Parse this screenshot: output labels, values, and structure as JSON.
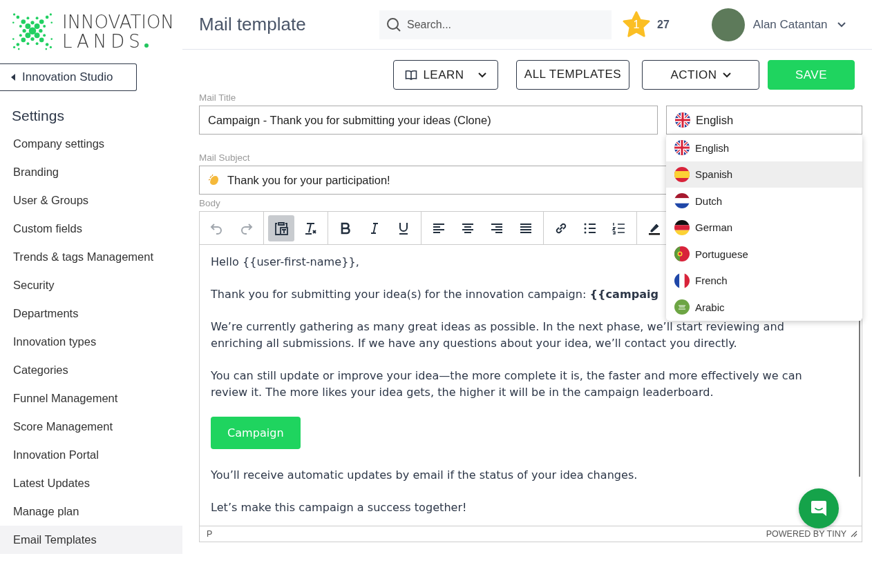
{
  "logo": {
    "line1": "INNOVATION",
    "line2": "LANDS"
  },
  "sidebar": {
    "back_button": "Innovation Studio",
    "heading": "Settings",
    "items": [
      {
        "label": "Company settings",
        "selected": false
      },
      {
        "label": "Branding",
        "selected": false
      },
      {
        "label": "User & Groups",
        "selected": false
      },
      {
        "label": "Custom fields",
        "selected": false
      },
      {
        "label": "Trends & tags Management",
        "selected": false
      },
      {
        "label": "Security",
        "selected": false
      },
      {
        "label": "Departments",
        "selected": false
      },
      {
        "label": "Innovation types",
        "selected": false
      },
      {
        "label": "Categories",
        "selected": false
      },
      {
        "label": "Funnel Management",
        "selected": false
      },
      {
        "label": "Score Management",
        "selected": false
      },
      {
        "label": "Innovation Portal",
        "selected": false
      },
      {
        "label": "Latest Updates",
        "selected": false
      },
      {
        "label": "Manage plan",
        "selected": false
      },
      {
        "label": "Email Templates",
        "selected": true
      }
    ]
  },
  "header": {
    "title": "Mail template",
    "search": {
      "placeholder": "Search..."
    },
    "badge": {
      "level": "1",
      "points": "27"
    },
    "user": {
      "name": "Alan Catantan"
    }
  },
  "actions": [
    {
      "label": "LEARN",
      "kind": "guide"
    },
    {
      "label": "ALL TEMPLATES",
      "kind": "plain"
    },
    {
      "label": "ACTION",
      "kind": "menu"
    },
    {
      "label": "SAVE",
      "kind": "primary"
    }
  ],
  "form": {
    "title_label": "Mail Title",
    "title_value": "Campaign - Thank you for submitting your ideas (Clone)",
    "language": {
      "value": "English",
      "kind": "uk"
    },
    "subject_label": "Mail Subject",
    "subject_value": "Thank you for your participation!",
    "body_label": "Body"
  },
  "languages": [
    {
      "name": "English",
      "kind": "uk",
      "selected": false
    },
    {
      "name": "Spanish",
      "kind": "spain",
      "selected": true
    },
    {
      "name": "Dutch",
      "kind": "netherlands",
      "selected": false
    },
    {
      "name": "German",
      "kind": "germany",
      "selected": false
    },
    {
      "name": "Portuguese",
      "kind": "portugal",
      "selected": false
    },
    {
      "name": "French",
      "kind": "france",
      "selected": false
    },
    {
      "name": "Arabic",
      "kind": "saudi",
      "selected": false
    }
  ],
  "editor": {
    "toolbar": [
      {
        "tools": [
          {
            "kind": "undo",
            "disabled": true
          },
          {
            "kind": "redo",
            "disabled": true
          }
        ]
      },
      {
        "tools": [
          {
            "kind": "pastetext",
            "on": true
          },
          {
            "kind": "clearformat",
            "on": false
          }
        ]
      },
      {
        "tools": [
          {
            "kind": "bold",
            "on": false
          },
          {
            "kind": "italic",
            "on": false
          },
          {
            "kind": "underline",
            "on": false
          }
        ]
      },
      {
        "tools": [
          {
            "kind": "alignleft",
            "on": false
          },
          {
            "kind": "aligncenter",
            "on": false
          },
          {
            "kind": "alignright",
            "on": false
          },
          {
            "kind": "justify",
            "on": false
          }
        ]
      },
      {
        "tools": [
          {
            "kind": "link",
            "on": false
          },
          {
            "kind": "bullets",
            "on": false
          },
          {
            "kind": "numbers",
            "on": false
          }
        ]
      },
      {
        "tools": [
          {
            "kind": "highlight",
            "on": false
          }
        ]
      }
    ],
    "content": [
      {
        "kind": "text",
        "text": "Hello {{user-first-name}},"
      },
      {
        "kind": "text",
        "text": "Thank you for submitting your idea(s) for the innovation campaign: **{{campaig**"
      },
      {
        "kind": "text",
        "text": "We’re currently gathering as many great ideas as possible. In the next phase, we’ll start reviewing and enriching all submissions. If we have any questions about your idea, we’ll contact you directly."
      },
      {
        "kind": "text",
        "text": "You can still update or improve your idea—the more complete it is, the faster and more effectively we can review it. The more likes your idea gets, the higher it will be in the campaign leaderboard."
      },
      {
        "kind": "button",
        "text": "Campaign"
      },
      {
        "kind": "text",
        "text": "You’ll receive automatic updates by email if the status of your idea changes."
      },
      {
        "kind": "text",
        "text": "Let’s make this campaign a success together!"
      }
    ],
    "path": "P",
    "branding": "POWERED BY TINY"
  }
}
